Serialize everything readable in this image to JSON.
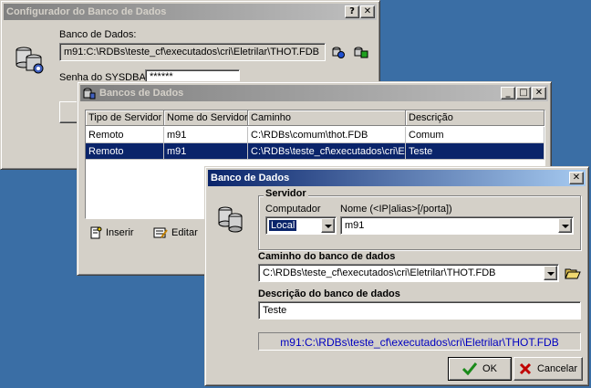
{
  "configurador": {
    "title": "Configurador do Banco de Dados",
    "title_buttons": [
      "?",
      "✕"
    ],
    "db_label": "Banco de Dados:",
    "db_value": "m91:C:\\RDBs\\teste_cf\\executados\\cri\\Eletrilar\\THOT.FDB",
    "password_label": "Senha do SYSDBA:",
    "password_value": "******"
  },
  "bancos": {
    "title": "Bancos de Dados",
    "title_buttons": [
      "_",
      "□",
      "✕"
    ],
    "columns": [
      "Tipo de Servidor",
      "Nome do Servidor",
      "Caminho",
      "Descrição"
    ],
    "rows": [
      [
        "Remoto",
        "m91",
        "C:\\RDBs\\comum\\thot.FDB",
        "Comum"
      ],
      [
        "Remoto",
        "m91",
        "C:\\RDBs\\teste_cf\\executados\\cri\\El",
        "Teste"
      ]
    ],
    "selected_row": 1,
    "insert_label": "Inserir",
    "edit_label": "Editar"
  },
  "dialog": {
    "title": "Banco de Dados",
    "close_glyph": "✕",
    "server_group": "Servidor",
    "computer_label": "Computador",
    "computer_value": "Local",
    "name_label": "Nome (<IP|alias>[/porta])",
    "name_value": "m91",
    "path_label": "Caminho do banco de dados",
    "path_value": "C:\\RDBs\\teste_cf\\executados\\cri\\Eletrilar\\THOT.FDB",
    "desc_label": "Descrição do banco de dados",
    "desc_value": "Teste",
    "connection_string": "m91:C:\\RDBs\\teste_cf\\executados\\cri\\Eletrilar\\THOT.FDB",
    "ok_label": "OK",
    "cancel_label": "Cancelar"
  },
  "colors": {
    "desktop": "#3a6ea5",
    "active_title": "#0a246a",
    "connection_text": "#0000c0",
    "ok_check": "#1a8a1a",
    "cancel_x": "#c00000"
  }
}
